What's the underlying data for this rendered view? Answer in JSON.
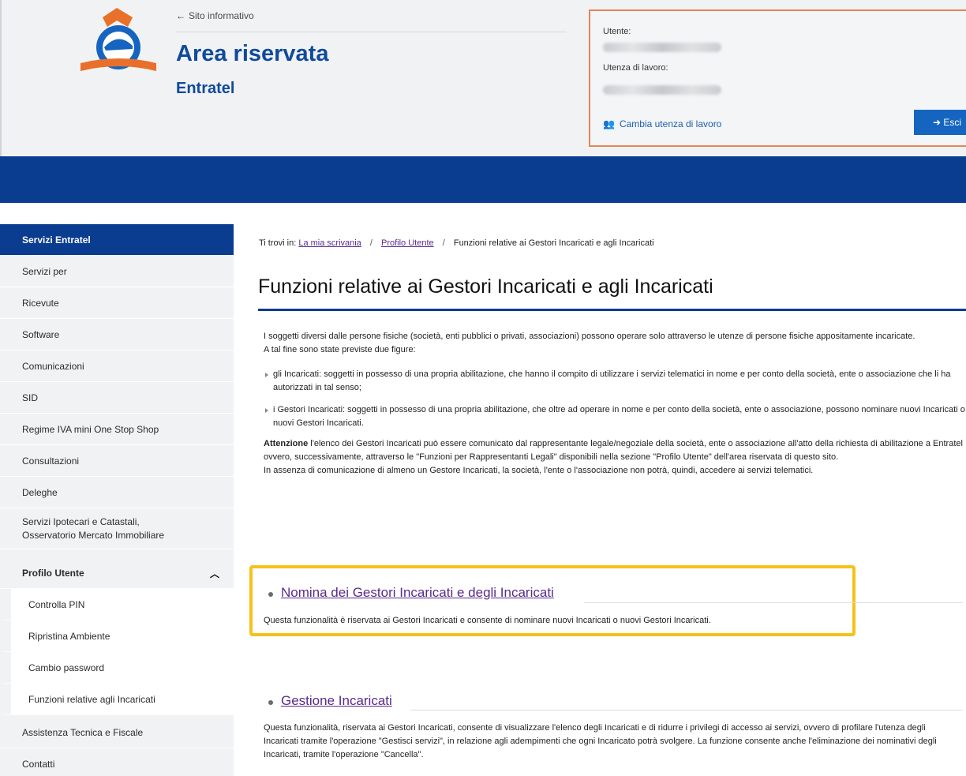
{
  "header": {
    "back_link": "Sito informativo",
    "title": "Area riservata",
    "subtitle": "Entratel",
    "user_box": {
      "user_label": "Utente:",
      "work_user_label": "Utenza di lavoro:",
      "change_label": "Cambia utenza di lavoro",
      "exit_label": "Esci"
    }
  },
  "sidebar": {
    "items": [
      {
        "label": "Servizi Entratel"
      },
      {
        "label": "Servizi per"
      },
      {
        "label": "Ricevute"
      },
      {
        "label": "Software"
      },
      {
        "label": "Comunicazioni"
      },
      {
        "label": "SID"
      },
      {
        "label": "Regime IVA mini One Stop Shop"
      },
      {
        "label": "Consultazioni"
      },
      {
        "label": "Deleghe"
      },
      {
        "label": "Servizi Ipotecari e Catastali, Osservatorio Mercato Immobiliare"
      },
      {
        "label": "Profilo Utente"
      },
      {
        "label": "Controlla PIN"
      },
      {
        "label": "Ripristina Ambiente"
      },
      {
        "label": "Cambio password"
      },
      {
        "label": "Funzioni relative agli Incaricati"
      },
      {
        "label": "Assistenza Tecnica e Fiscale"
      },
      {
        "label": "Contatti"
      }
    ]
  },
  "breadcrumb": {
    "prefix": "Ti trovi in:",
    "items": [
      "La mia scrivania",
      "Profilo Utente",
      "Funzioni relative ai Gestori Incaricati e agli Incaricati"
    ]
  },
  "main": {
    "title": "Funzioni relative ai Gestori Incaricati e agli Incaricati",
    "intro": "I soggetti diversi dalle persone fisiche (società, enti pubblici o privati, associazioni) possono operare solo attraverso le utenze di persone fisiche appositamente incaricate.",
    "intro2": "A tal fine sono state previste due figure:",
    "bullets": [
      "gli Incaricati: soggetti in possesso di una propria abilitazione, che hanno il compito di utilizzare i servizi telematici in nome e per conto della società, ente o associazione che li ha autorizzati in tal senso;",
      "i Gestori Incaricati: soggetti in possesso di una propria abilitazione, che oltre ad operare in nome e per conto della società, ente o associazione, possono nominare nuovi Incaricati o nuovi Gestori Incaricati."
    ],
    "attention_label": "Attenzione",
    "attention_text": "l'elenco dei Gestori Incaricati può essere comunicato dal rappresentante legale/negoziale della società, ente o associazione all'atto della richiesta di abilitazione a Entratel ovvero, successivamente, attraverso le \"Funzioni per Rappresentanti Legali\" disponibili nella sezione \"Profilo Utente\" dell'area riservata di questo sito.",
    "attention_text2": "In assenza di comunicazione di almeno un Gestore Incaricati, la società, l'ente o l'associazione non potrà, quindi, accedere ai servizi telematici.",
    "sections": [
      {
        "link": "Nomina dei Gestori Incaricati e degli Incaricati",
        "text": "Questa funzionalità è riservata ai Gestori Incaricati e consente di nominare nuovi Incaricati o nuovi Gestori Incaricati."
      },
      {
        "link": "Gestione Incaricati",
        "text": "Questa funzionalità, riservata ai Gestori Incaricati, consente di visualizzare l'elenco degli Incaricati e di ridurre i privilegi di accesso ai servizi, ovvero di profilare l'utenza degli Incaricati tramite l'operazione \"Gestisci servizi\", in relazione agli adempimenti che ogni Incaricato potrà svolgere. La funzione consente anche l'eliminazione dei nominativi degli Incaricati, tramite l'operazione \"Cancella\"."
      }
    ]
  },
  "colors": {
    "brand_blue": "#0a3c8f",
    "highlight": "#f5c21b",
    "user_box_border": "#e2855a",
    "link_visited": "#5a2a8a"
  }
}
